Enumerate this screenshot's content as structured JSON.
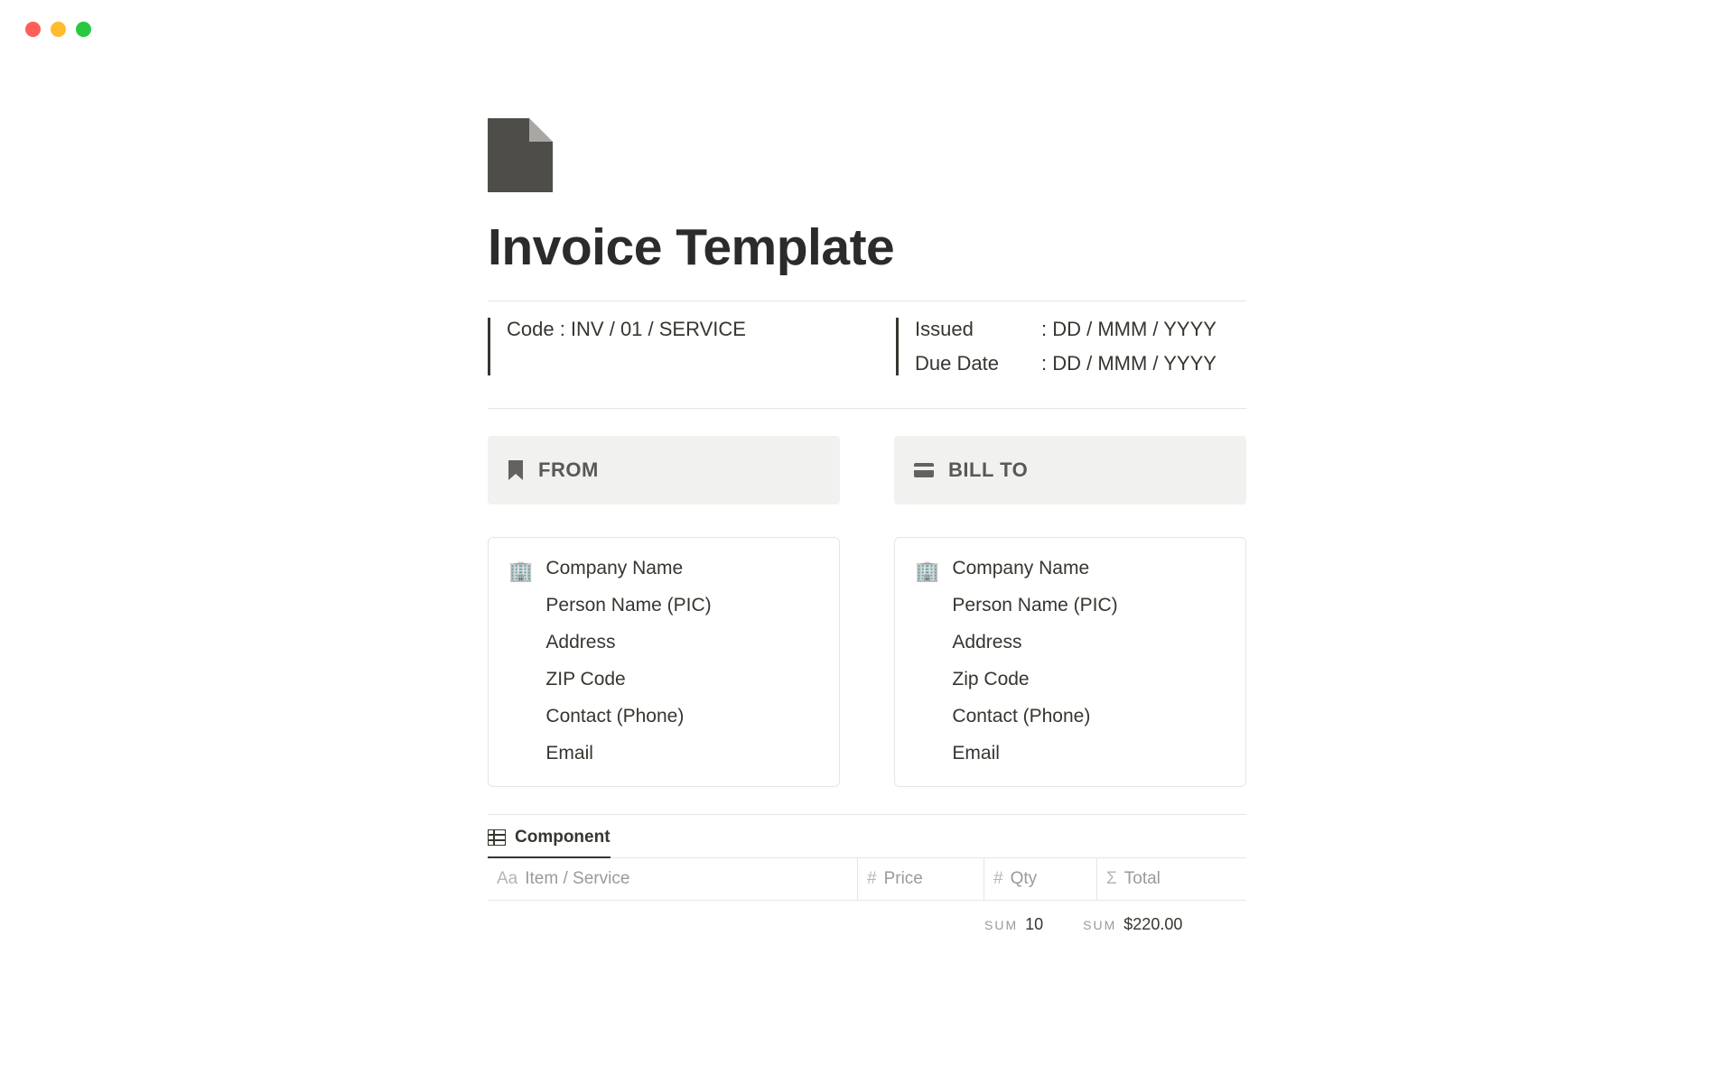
{
  "title": "Invoice Template",
  "meta": {
    "code_label": "Code : INV / 01 / SERVICE",
    "issued_k": "Issued",
    "issued_v": ": DD / MMM / YYYY",
    "due_k": "Due Date",
    "due_v": ": DD / MMM / YYYY"
  },
  "sections": {
    "from": "FROM",
    "bill_to": "BILL TO"
  },
  "from_card": {
    "emoji": "🏢",
    "company": "Company Name",
    "person": "Person Name (PIC)",
    "address": "Address",
    "zip": "ZIP Code",
    "contact": "Contact (Phone)",
    "email": "Email"
  },
  "billto_card": {
    "emoji": "🏢",
    "company": "Company Name",
    "person": "Person Name (PIC)",
    "address": "Address",
    "zip": "Zip Code",
    "contact": "Contact (Phone)",
    "email": "Email"
  },
  "db": {
    "label": "Component",
    "columns": {
      "item": "Item / Service",
      "price": "Price",
      "qty": "Qty",
      "total": "Total"
    },
    "sum_qty_label": "SUM",
    "sum_qty_value": "10",
    "sum_total_label": "SUM",
    "sum_total_value": "$220.00"
  }
}
